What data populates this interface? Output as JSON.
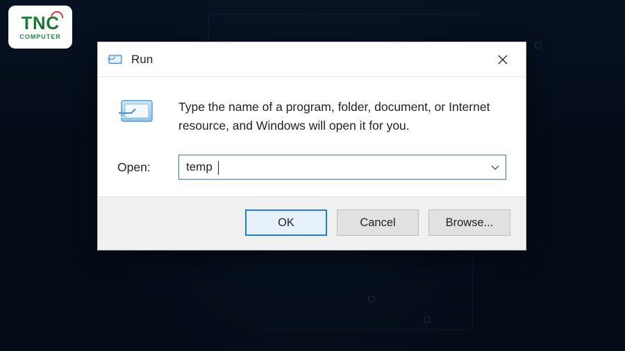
{
  "logo": {
    "brand": "TNC",
    "sub": "COMPUTER"
  },
  "dialog": {
    "title": "Run",
    "description": "Type the name of a program, folder, document, or Internet resource, and Windows will open it for you.",
    "open_label": "Open:",
    "input_value": "temp",
    "buttons": {
      "ok": "OK",
      "cancel": "Cancel",
      "browse": "Browse..."
    }
  }
}
